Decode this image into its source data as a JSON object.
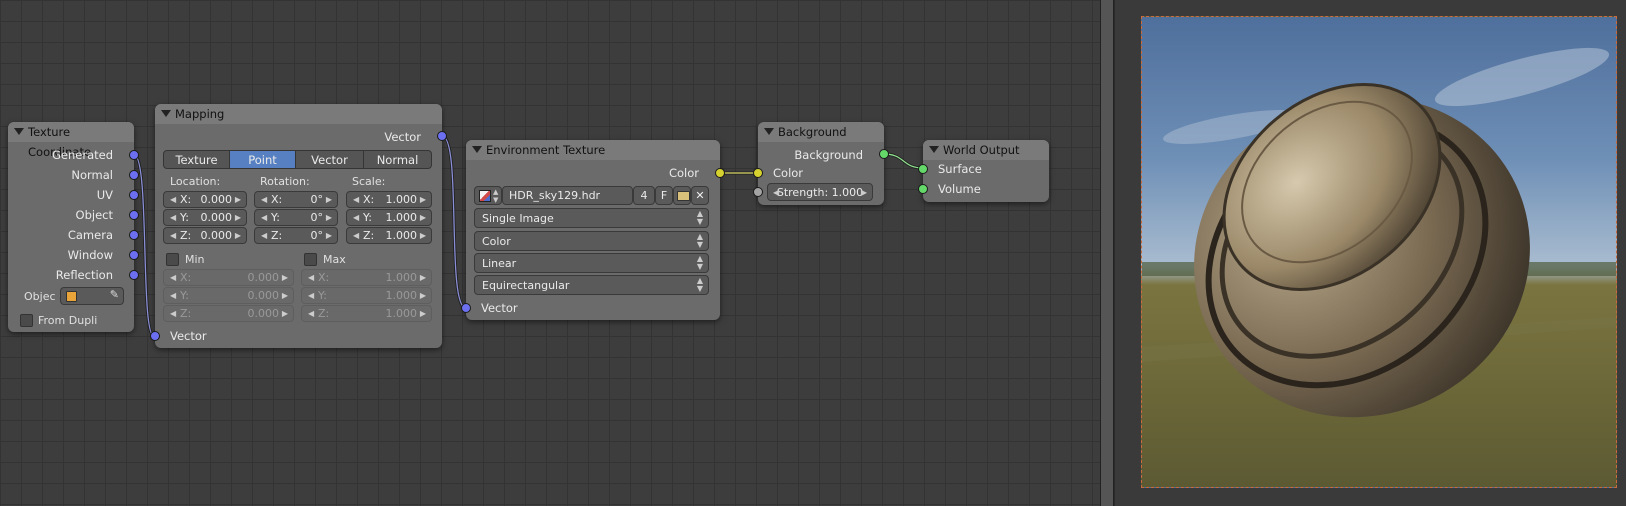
{
  "nodes": {
    "texcoord": {
      "title": "Texture Coordinate",
      "outputs": [
        "Generated",
        "Normal",
        "UV",
        "Object",
        "Camera",
        "Window",
        "Reflection"
      ],
      "object_label": "Objec",
      "from_dupli": "From Dupli"
    },
    "mapping": {
      "title": "Mapping",
      "output": "Vector",
      "tabs": [
        "Texture",
        "Point",
        "Vector",
        "Normal"
      ],
      "selected_tab": "Point",
      "location_label": "Location:",
      "rotation_label": "Rotation:",
      "scale_label": "Scale:",
      "location": [
        {
          "axis": "X:",
          "value": "0.000"
        },
        {
          "axis": "Y:",
          "value": "0.000"
        },
        {
          "axis": "Z:",
          "value": "0.000"
        }
      ],
      "rotation": [
        {
          "axis": "X:",
          "value": "0°"
        },
        {
          "axis": "Y:",
          "value": "0°"
        },
        {
          "axis": "Z:",
          "value": "0°"
        }
      ],
      "scale": [
        {
          "axis": "X:",
          "value": "1.000"
        },
        {
          "axis": "Y:",
          "value": "1.000"
        },
        {
          "axis": "Z:",
          "value": "1.000"
        }
      ],
      "min_label": "Min",
      "max_label": "Max",
      "min": [
        {
          "axis": "X:",
          "value": "0.000"
        },
        {
          "axis": "Y:",
          "value": "0.000"
        },
        {
          "axis": "Z:",
          "value": "0.000"
        }
      ],
      "max": [
        {
          "axis": "X:",
          "value": "1.000"
        },
        {
          "axis": "Y:",
          "value": "1.000"
        },
        {
          "axis": "Z:",
          "value": "1.000"
        }
      ],
      "input": "Vector"
    },
    "envtex": {
      "title": "Environment Texture",
      "output": "Color",
      "image_name": "HDR_sky129.hdr",
      "users": "4",
      "fake_user": "F",
      "source": "Single Image",
      "color_space": "Color",
      "interpolation": "Linear",
      "projection": "Equirectangular",
      "input": "Vector"
    },
    "background": {
      "title": "Background",
      "output": "Background",
      "color_input": "Color",
      "strength": "Strength: 1.000"
    },
    "world_output": {
      "title": "World Output",
      "surface": "Surface",
      "volume": "Volume"
    }
  },
  "icons": [
    "collapse-triangle-icon",
    "object-cube-icon",
    "eyedropper-icon",
    "image-icon",
    "folder-icon",
    "close-icon"
  ],
  "colors": {
    "vector_socket": "#6b6ff0",
    "color_socket": "#d6d12e",
    "shader_socket": "#64d96a",
    "selected_tab": "#5680c2",
    "render_border": "#c86a3b"
  }
}
